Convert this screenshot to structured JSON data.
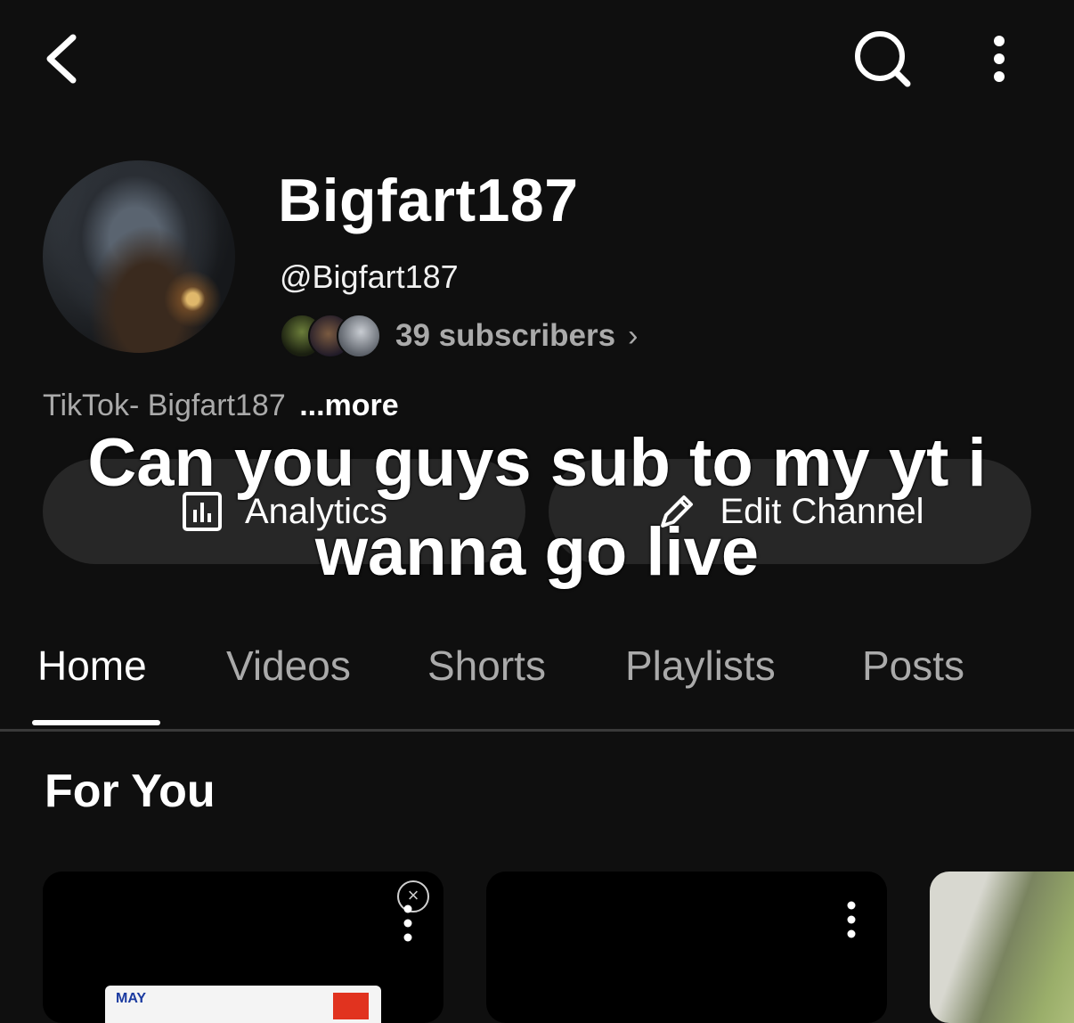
{
  "channel": {
    "name": "Bigfart187",
    "handle": "@Bigfart187",
    "subscribers": "39 subscribers",
    "description": "TikTok- Bigfart187",
    "more_label": "...more"
  },
  "actions": {
    "analytics": "Analytics",
    "edit_channel": "Edit Channel"
  },
  "overlay_caption": "Can you guys sub to my yt i wanna go live",
  "tabs": [
    "Home",
    "Videos",
    "Shorts",
    "Playlists",
    "Posts"
  ],
  "active_tab": "Home",
  "section": {
    "title": "For You"
  },
  "cards": [
    {
      "thumb_text": "MAY"
    }
  ],
  "icons": {
    "back": "back-chevron-icon",
    "search": "search-icon",
    "more": "more-vertical-icon",
    "analytics": "analytics-icon",
    "edit": "pencil-icon",
    "close": "close-icon"
  }
}
